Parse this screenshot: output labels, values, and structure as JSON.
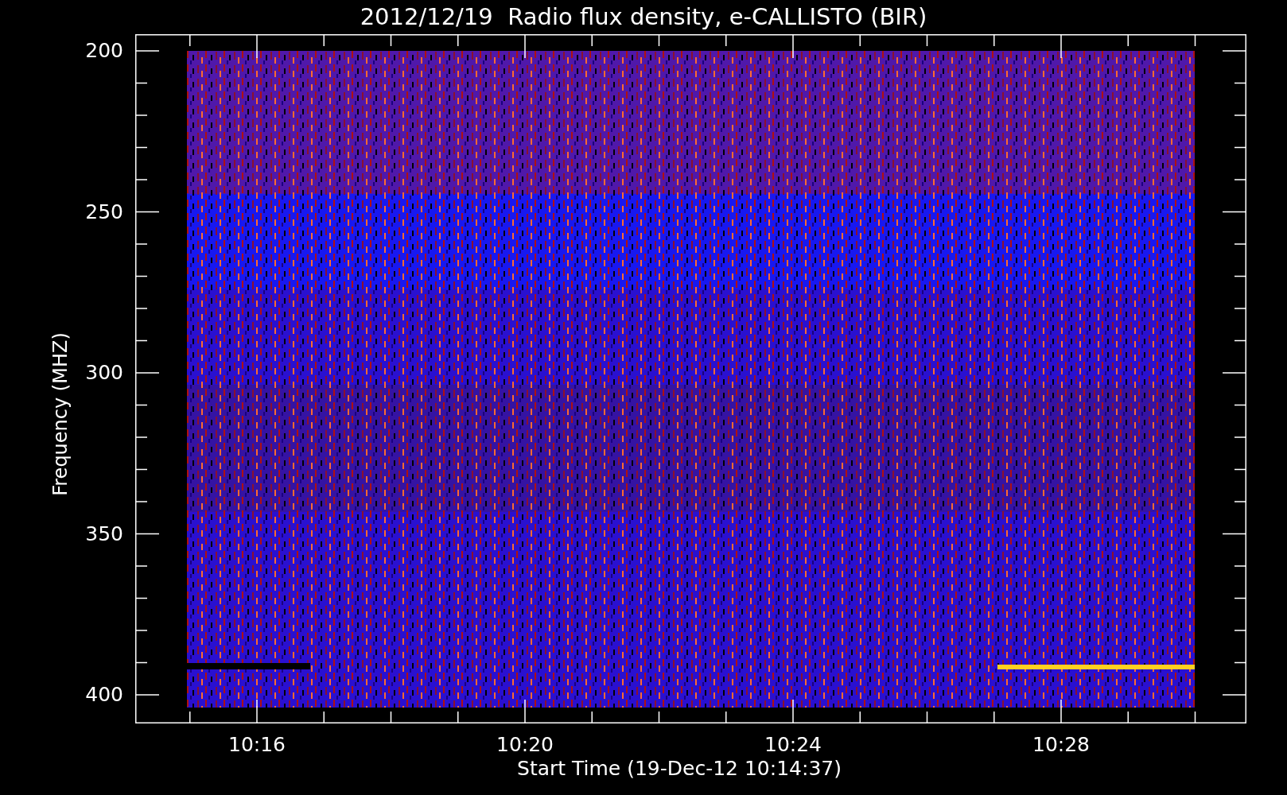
{
  "title": "2012/12/19  Radio flux density, e-CALLISTO (BIR)",
  "y_axis": {
    "label": "Frequency (MHZ)",
    "ticks": [
      "200",
      "250",
      "300",
      "350",
      "400"
    ]
  },
  "x_axis": {
    "label": "Start Time (19-Dec-12 10:14:37)",
    "ticks": [
      "10:16",
      "10:20",
      "10:24",
      "10:28"
    ]
  }
}
